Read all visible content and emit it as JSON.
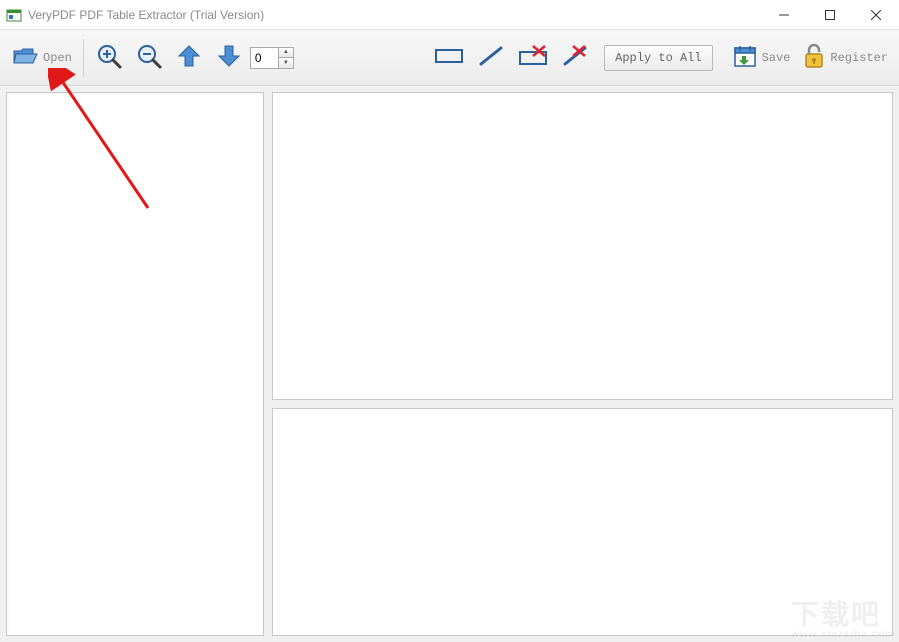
{
  "window": {
    "title": "VeryPDF PDF Table Extractor (Trial Version)"
  },
  "toolbar": {
    "open_label": "Open",
    "page_value": "0",
    "apply_label": "Apply to All",
    "save_label": "Save",
    "register_label": "Register"
  },
  "icons": {
    "open": "folder-open-icon",
    "zoom_in": "zoom-in-icon",
    "zoom_out": "zoom-out-icon",
    "prev": "arrow-up-icon",
    "next": "arrow-down-icon",
    "rect": "rectangle-icon",
    "line": "line-icon",
    "del_rect": "delete-rectangle-icon",
    "del_line": "delete-line-icon",
    "save": "calendar-save-icon",
    "register": "padlock-icon",
    "app": "app-icon"
  },
  "watermark": {
    "text": "下载吧",
    "url": "www.xiazaiba.com"
  }
}
